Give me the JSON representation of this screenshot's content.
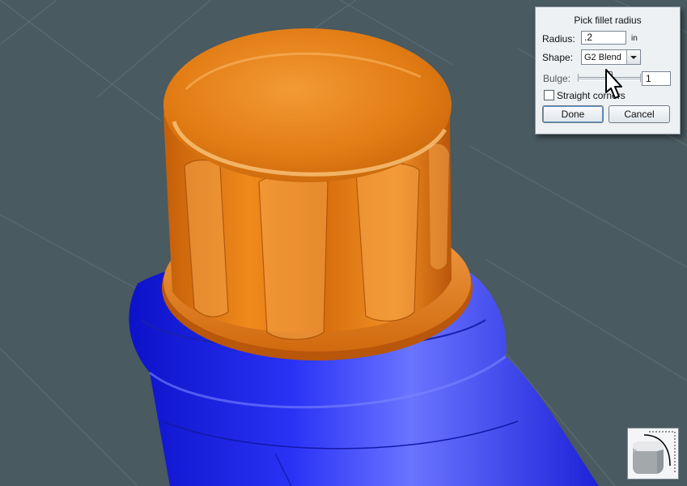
{
  "dialog": {
    "title": "Pick fillet radius",
    "radius_label": "Radius:",
    "radius_value": ".2",
    "radius_unit": "in",
    "shape_label": "Shape:",
    "shape_value": "G2 Blend",
    "bulge_label": "Bulge:",
    "bulge_value": "1",
    "straight_corners_label": "Straight corners",
    "straight_corners_checked": false,
    "done_label": "Done",
    "cancel_label": "Cancel"
  },
  "icons": {
    "fillet_tool": "fillet-tool-icon",
    "cursor": "arrow-cursor-icon",
    "dropdown": "chevron-down-icon"
  },
  "colors": {
    "viewport_background": "#495a60",
    "cap": "#e07a10",
    "bottle": "#2a2ef0"
  }
}
